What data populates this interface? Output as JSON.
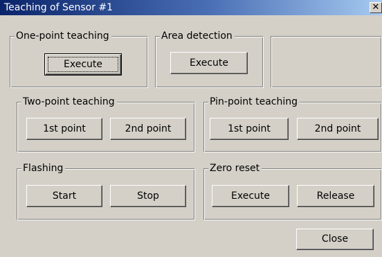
{
  "window": {
    "title": "Teaching of Sensor #1",
    "close_glyph": "✕"
  },
  "groups": {
    "one_point": {
      "label": "One-point teaching",
      "execute_label": "Execute"
    },
    "area": {
      "label": "Area detection",
      "execute_label": "Execute"
    },
    "two_point": {
      "label": "Two-point teaching",
      "first_label": "1st point",
      "second_label": "2nd point"
    },
    "pin_point": {
      "label": "Pin-point teaching",
      "first_label": "1st point",
      "second_label": "2nd point"
    },
    "flashing": {
      "label": "Flashing",
      "start_label": "Start",
      "stop_label": "Stop"
    },
    "zero_reset": {
      "label": "Zero reset",
      "execute_label": "Execute",
      "release_label": "Release"
    }
  },
  "footer": {
    "close_label": "Close"
  },
  "colors": {
    "face": "#d4d0c8",
    "title_start": "#0a246a",
    "title_end": "#a6caf0"
  }
}
